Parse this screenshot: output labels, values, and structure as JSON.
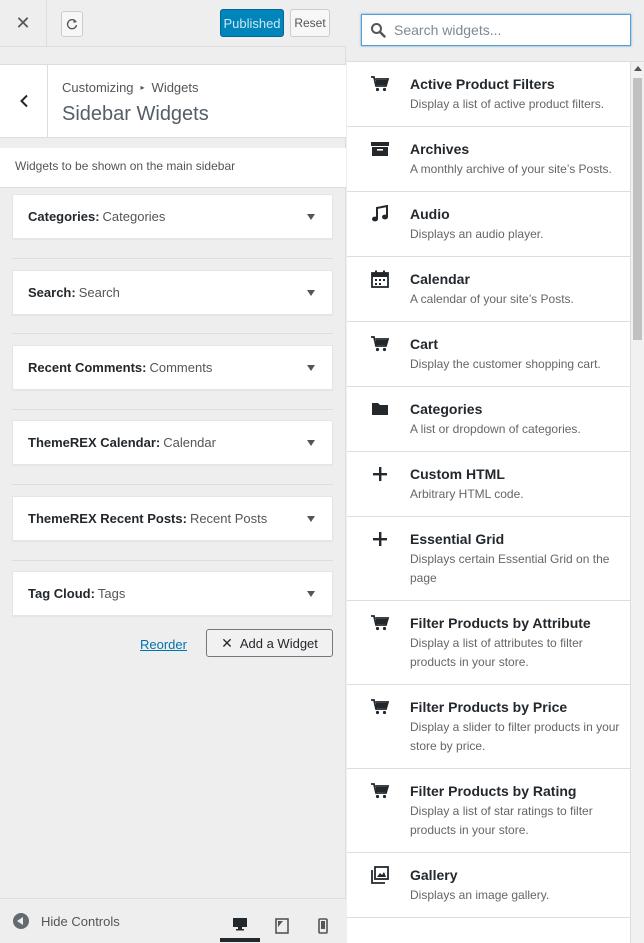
{
  "header": {
    "close_glyph": "✕",
    "publish_label": "Published",
    "reset_label": "Reset"
  },
  "section": {
    "breadcrumb_parent": "Customizing",
    "breadcrumb_sep": "▸",
    "breadcrumb_current": "Widgets",
    "title": "Sidebar Widgets",
    "description": "Widgets to be shown on the main sidebar"
  },
  "widgets": [
    {
      "name": "Categories:",
      "title": "Categories"
    },
    {
      "name": "Search:",
      "title": "Search"
    },
    {
      "name": "Recent Comments:",
      "title": "Comments"
    },
    {
      "name": "ThemeREX Calendar:",
      "title": "Calendar"
    },
    {
      "name": "ThemeREX Recent Posts:",
      "title": "Recent Posts"
    },
    {
      "name": "Tag Cloud:",
      "title": "Tags"
    }
  ],
  "actions": {
    "reorder_label": "Reorder",
    "add_widget_label": "Add a Widget",
    "add_widget_glyph": "✕"
  },
  "footer": {
    "hide_controls_label": "Hide Controls",
    "devices": [
      "desktop",
      "tablet",
      "mobile"
    ]
  },
  "search": {
    "placeholder": "Search widgets..."
  },
  "available_widgets": [
    {
      "name": "Active Product Filters",
      "desc": "Display a list of active product filters.",
      "icon": "cart-icon"
    },
    {
      "name": "Archives",
      "desc": "A monthly archive of your site’s Posts.",
      "icon": "archive-icon"
    },
    {
      "name": "Audio",
      "desc": "Displays an audio player.",
      "icon": "music-icon"
    },
    {
      "name": "Calendar",
      "desc": "A calendar of your site’s Posts.",
      "icon": "calendar-icon"
    },
    {
      "name": "Cart",
      "desc": "Display the customer shopping cart.",
      "icon": "cart-icon"
    },
    {
      "name": "Categories",
      "desc": "A list or dropdown of categories.",
      "icon": "folder-icon"
    },
    {
      "name": "Custom HTML",
      "desc": "Arbitrary HTML code.",
      "icon": "plus-icon"
    },
    {
      "name": "Essential Grid",
      "desc": "Displays certain Essential Grid on the page",
      "icon": "plus-icon"
    },
    {
      "name": "Filter Products by Attribute",
      "desc": "Display a list of attributes to filter products in your store.",
      "icon": "cart-icon"
    },
    {
      "name": "Filter Products by Price",
      "desc": "Display a slider to filter products in your store by price.",
      "icon": "cart-icon"
    },
    {
      "name": "Filter Products by Rating",
      "desc": "Display a list of star ratings to filter products in your store.",
      "icon": "cart-icon"
    },
    {
      "name": "Gallery",
      "desc": "Displays an image gallery.",
      "icon": "gallery-icon"
    }
  ],
  "colors": {
    "accent": "#0085ba",
    "link": "#0073aa",
    "panel_bg": "#eeeeee"
  }
}
